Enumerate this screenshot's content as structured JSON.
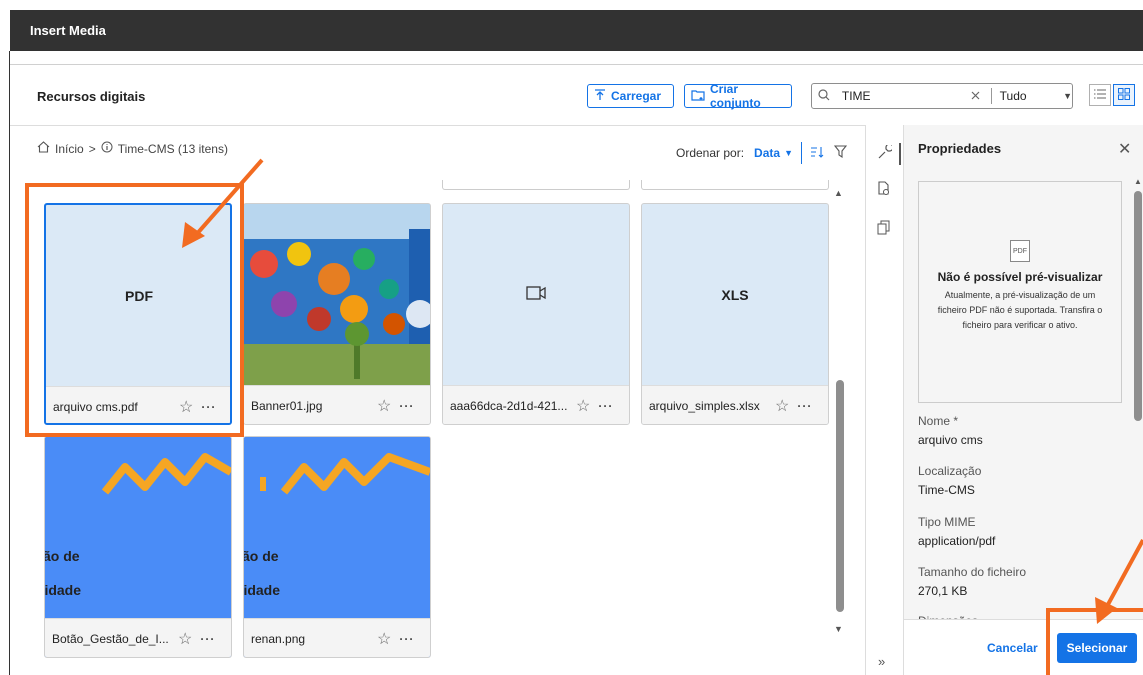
{
  "window": {
    "title": "Insert Media"
  },
  "header": {
    "title": "Recursos digitais",
    "upload_label": "Carregar",
    "create_set_label": "Criar conjunto",
    "search": {
      "value": "TIME",
      "filter_value": "Tudo",
      "clear_icon": "close-icon"
    }
  },
  "breadcrumb": {
    "home": "Início",
    "separator": ">",
    "folder": "Time-CMS (13 itens)"
  },
  "sort": {
    "label": "Ordenar por:",
    "value": "Data"
  },
  "cards": [
    {
      "name": "arquivo cms.pdf",
      "thumb_label": "PDF"
    },
    {
      "name": "Banner01.jpg",
      "thumb_label": ""
    },
    {
      "name": "aaa66dca-2d1d-421...",
      "thumb_label": ""
    },
    {
      "name": "arquivo_simples.xlsx",
      "thumb_label": "XLS"
    },
    {
      "name": "Botão_Gestão_de_I...",
      "thumb_line1": "ão de",
      "thumb_line2": "ridade"
    },
    {
      "name": "renan.png",
      "thumb_line1": "ão de",
      "thumb_line2": "ridade"
    }
  ],
  "properties": {
    "title": "Propriedades",
    "preview_title": "Não é possível pré-visualizar",
    "preview_desc": "Atualmente, a pré-visualização de um ficheiro PDF não é suportada. Transfira o ficheiro para verificar o ativo.",
    "pdf_icon_label": "PDF",
    "fields": [
      {
        "label": "Nome *",
        "value": "arquivo cms"
      },
      {
        "label": "Localização",
        "value": "Time-CMS"
      },
      {
        "label": "Tipo MIME",
        "value": "application/pdf"
      },
      {
        "label": "Tamanho do ficheiro",
        "value": "270,1 KB"
      },
      {
        "label": "Dimensões",
        "value": ""
      }
    ]
  },
  "footer": {
    "cancel_label": "Cancelar",
    "select_label": "Selecionar"
  },
  "colors": {
    "accent": "#1473e6",
    "annotation": "#f26b21",
    "titlebar": "#323232"
  }
}
